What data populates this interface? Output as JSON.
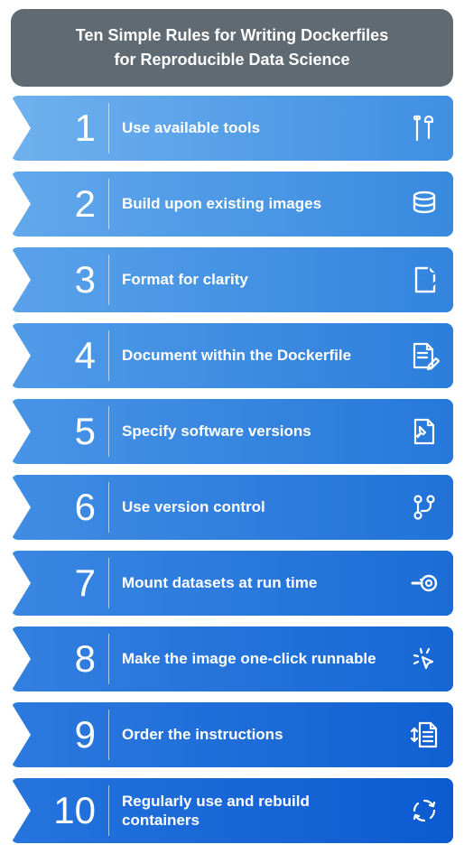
{
  "header": {
    "line1": "Ten Simple Rules for Writing Dockerfiles",
    "line2": "for Reproducible Data Science"
  },
  "rules": [
    {
      "num": "1",
      "label": "Use available tools",
      "icon": "tools-icon",
      "gradient": [
        "#6fb1ee",
        "#3f8fe2"
      ]
    },
    {
      "num": "2",
      "label": "Build upon existing images",
      "icon": "database-icon",
      "gradient": [
        "#62a8ec",
        "#388adf"
      ]
    },
    {
      "num": "3",
      "label": "Format for clarity",
      "icon": "checklist-icon",
      "gradient": [
        "#5aa2ea",
        "#3284de"
      ]
    },
    {
      "num": "4",
      "label": "Document within the Dockerfile",
      "icon": "edit-doc-icon",
      "gradient": [
        "#519be8",
        "#2c7edc"
      ]
    },
    {
      "num": "5",
      "label": "Specify software versions",
      "icon": "pin-file-icon",
      "gradient": [
        "#4994e6",
        "#2678da"
      ]
    },
    {
      "num": "6",
      "label": "Use version control",
      "icon": "git-branch-icon",
      "gradient": [
        "#418de4",
        "#2172d8"
      ]
    },
    {
      "num": "7",
      "label": "Mount datasets at run time",
      "icon": "mount-icon",
      "gradient": [
        "#3a87e2",
        "#1b6cd6"
      ]
    },
    {
      "num": "8",
      "label": "Make the image one-click runnable",
      "icon": "click-icon",
      "gradient": [
        "#3380e0",
        "#1666d4"
      ]
    },
    {
      "num": "9",
      "label": "Order the instructions",
      "icon": "order-doc-icon",
      "gradient": [
        "#2c7ade",
        "#1160d2"
      ]
    },
    {
      "num": "10",
      "label": "Regularly use and rebuild containers",
      "icon": "refresh-icon",
      "gradient": [
        "#2674dc",
        "#0c5ad0"
      ]
    }
  ]
}
